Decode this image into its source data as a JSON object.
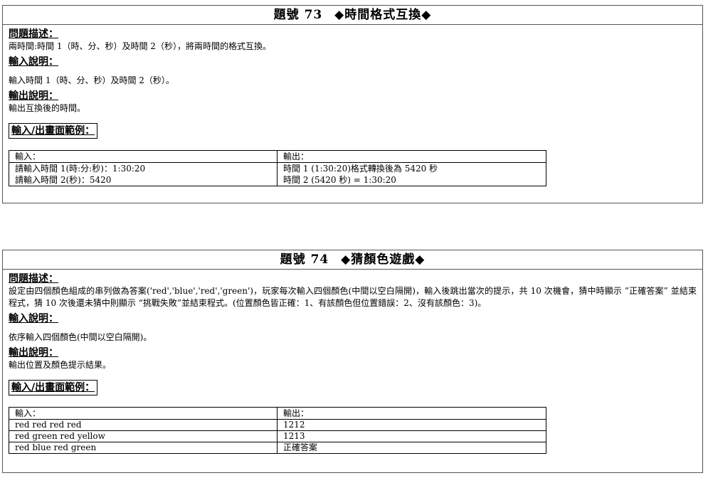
{
  "p73": {
    "num": "題號 73",
    "title": "◆時間格式互換◆",
    "desc_heading": "問題描述：",
    "desc": "兩時間:時間 1（時、分、秒）及時間 2（秒），將兩時間的格式互換。",
    "input_heading": "輸入說明：",
    "input_text": "輸入時間 1（時、分、秒）及時間 2（秒）。",
    "output_heading": "輸出說明：",
    "output_text": "輸出互換後的時間。",
    "example_heading": "輸入/出畫面範例：",
    "in_label": "輸入：",
    "out_label": "輸出：",
    "in_lines": [
      "請輸入時間 1(時:分:秒)：1:30:20",
      "請輸入時間 2(秒)：5420"
    ],
    "out_lines": [
      "時間 1 (1:30:20)格式轉換後為  5420  秒",
      "時間 2 (5420 秒) = 1:30:20"
    ]
  },
  "p74": {
    "num": "題號 74",
    "title": "◆猜顏色遊戲◆",
    "desc_heading": "問題描述：",
    "desc": "設定由四個顏色組成的串列做為答案('red','blue','red','green')，玩家每次輸入四個顏色(中間以空白隔開)，輸入後跳出當次的提示，共 10 次機會，猜中時顯示 ”正確答案” 並結束程式，猜 10 次後還未猜中則顯示 “挑戰失敗”並結束程式。(位置顏色皆正確：1、有該顏色但位置錯誤：2、沒有該顏色：3)。",
    "input_heading": "輸入說明：",
    "input_text": "依序輸入四個顏色(中間以空白隔開)。",
    "output_heading": "輸出說明：",
    "output_text": "輸出位置及顏色提示結果。",
    "example_heading": "輸入/出畫面範例：",
    "in_label": "輸入：",
    "out_label": "輸出：",
    "rows": [
      {
        "in": "red red red red",
        "out": "1212"
      },
      {
        "in": "red green red yellow",
        "out": "1213"
      },
      {
        "in": "red blue red green",
        "out": "正確答案"
      }
    ]
  }
}
